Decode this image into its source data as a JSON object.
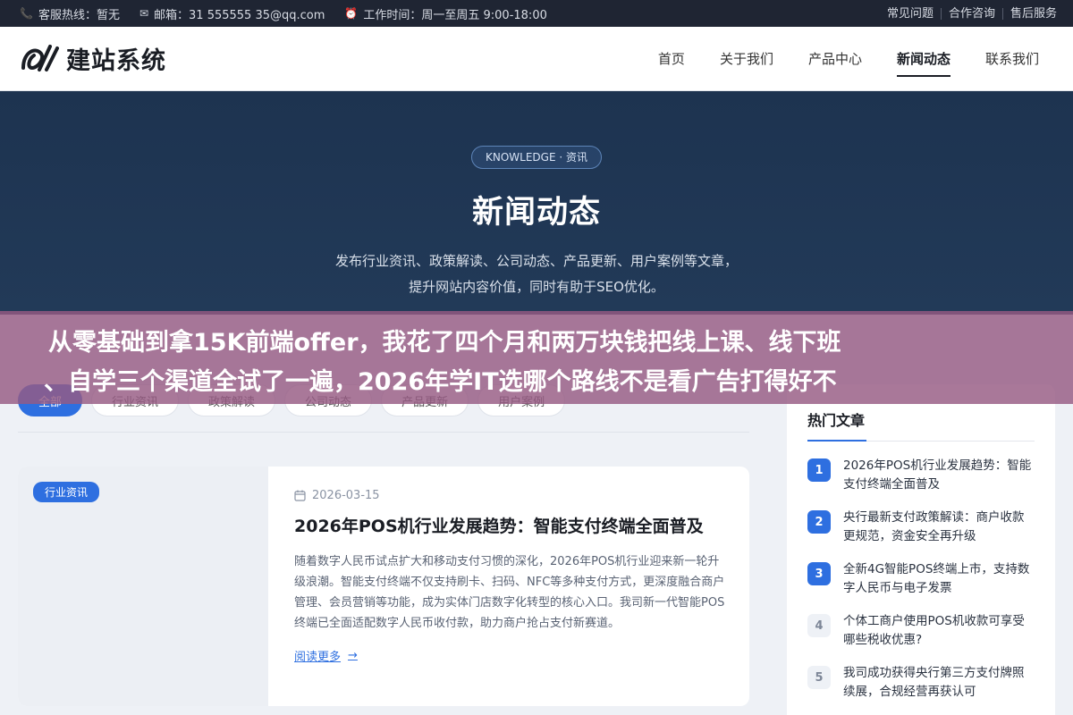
{
  "topbar": {
    "hotline": "客服热线：暂无",
    "email": "邮箱：31 555555 35@qq.com",
    "hours": "工作时间：周一至周五 9:00-18:00",
    "links": [
      "常见问题",
      "合作咨询",
      "售后服务"
    ]
  },
  "header": {
    "logo_text": "建站系统",
    "nav": [
      "首页",
      "关于我们",
      "产品中心",
      "新闻动态",
      "联系我们"
    ],
    "active_nav": "新闻动态"
  },
  "hero": {
    "badge": "KNOWLEDGE · 资讯",
    "title": "新闻动态",
    "desc_line1": "发布行业资讯、政策解读、公司动态、产品更新、用户案例等文章，",
    "desc_line2": "提升网站内容价值，同时有助于SEO优化。"
  },
  "overlay": {
    "line1": "从零基础到拿15K前端offer，我花了四个月和两万块钱把线上课、线下班",
    "line2": "、自学三个渠道全试了一遍，2026年学IT选哪个路线不是看广告打得好不"
  },
  "tabs": [
    "全部",
    "行业资讯",
    "政策解读",
    "公司动态",
    "产品更新",
    "用户案例"
  ],
  "article": {
    "category": "行业资讯",
    "date": "2026-03-15",
    "title": "2026年POS机行业发展趋势：智能支付终端全面普及",
    "excerpt": "随着数字人民币试点扩大和移动支付习惯的深化，2026年POS机行业迎来新一轮升级浪潮。智能支付终端不仅支持刷卡、扫码、NFC等多种支付方式，更深度融合商户管理、会员营销等功能，成为实体门店数字化转型的核心入口。我司新一代智能POS终端已全面适配数字人民币收付款，助力商户抢占支付新赛道。",
    "read_more": "阅读更多"
  },
  "sidebar": {
    "title": "热门文章",
    "items": [
      {
        "num": "1",
        "title": "2026年POS机行业发展趋势：智能支付终端全面普及"
      },
      {
        "num": "2",
        "title": "央行最新支付政策解读：商户收款更规范，资金安全再升级"
      },
      {
        "num": "3",
        "title": "全新4G智能POS终端上市，支持数字人民币与电子发票"
      },
      {
        "num": "4",
        "title": "个体工商户使用POS机收款可享受哪些税收优惠?"
      },
      {
        "num": "5",
        "title": "我司成功获得央行第三方支付牌照续展，合规经营再获认可"
      }
    ]
  },
  "colors": {
    "accent": "#2e6fe0",
    "hero_bg": "#1d3350",
    "overlay_bg": "#965a82",
    "topbar_bg": "#1f2533"
  }
}
